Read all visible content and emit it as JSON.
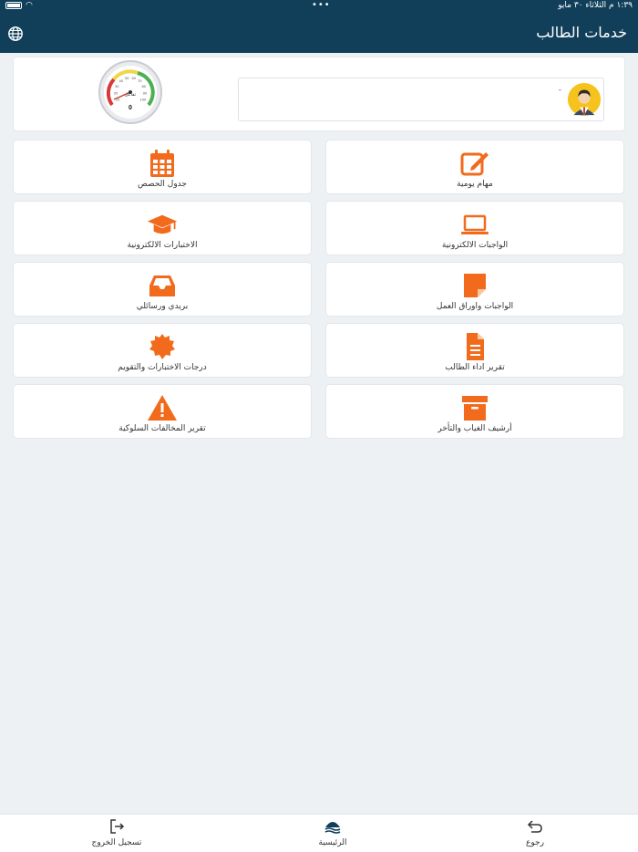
{
  "status_bar": {
    "time_date": "١:٣٩ م   الثلاثاء ٣٠ مايو",
    "dots": "•••"
  },
  "header": {
    "title": "خدمات الطالب",
    "globe_icon": "globe-icon"
  },
  "profile": {
    "name": "-",
    "gauge_label": "تفاعل",
    "gauge_value": "0",
    "gauge_ticks": [
      "10",
      "20",
      "30",
      "40",
      "50",
      "60",
      "70",
      "80",
      "90",
      "100"
    ]
  },
  "tiles": [
    {
      "label": "مهام يومية",
      "icon": "edit-icon"
    },
    {
      "label": "جدول الحصص",
      "icon": "calendar-icon"
    },
    {
      "label": "الواجبات الالكترونية",
      "icon": "laptop-icon"
    },
    {
      "label": "الاختبارات الالكترونية",
      "icon": "graduation-cap-icon"
    },
    {
      "label": "الواجبات واوراق العمل",
      "icon": "sticky-note-icon"
    },
    {
      "label": "بريدي ورسائلي",
      "icon": "inbox-icon"
    },
    {
      "label": "تقرير اداء الطالب",
      "icon": "document-icon"
    },
    {
      "label": "درجات الاختبارات والتقويم",
      "icon": "badge-icon"
    },
    {
      "label": "أرشيف الغياب والتأخر",
      "icon": "archive-box-icon"
    },
    {
      "label": "تقرير المخالفات السلوكية",
      "icon": "warning-icon"
    }
  ],
  "bottom_nav": {
    "back": "رجوع",
    "home": "الرئيسية",
    "logout": "تسجيل الخروج"
  },
  "colors": {
    "header": "#113f5a",
    "accent": "#f26b1d",
    "background": "#eef1f4"
  }
}
